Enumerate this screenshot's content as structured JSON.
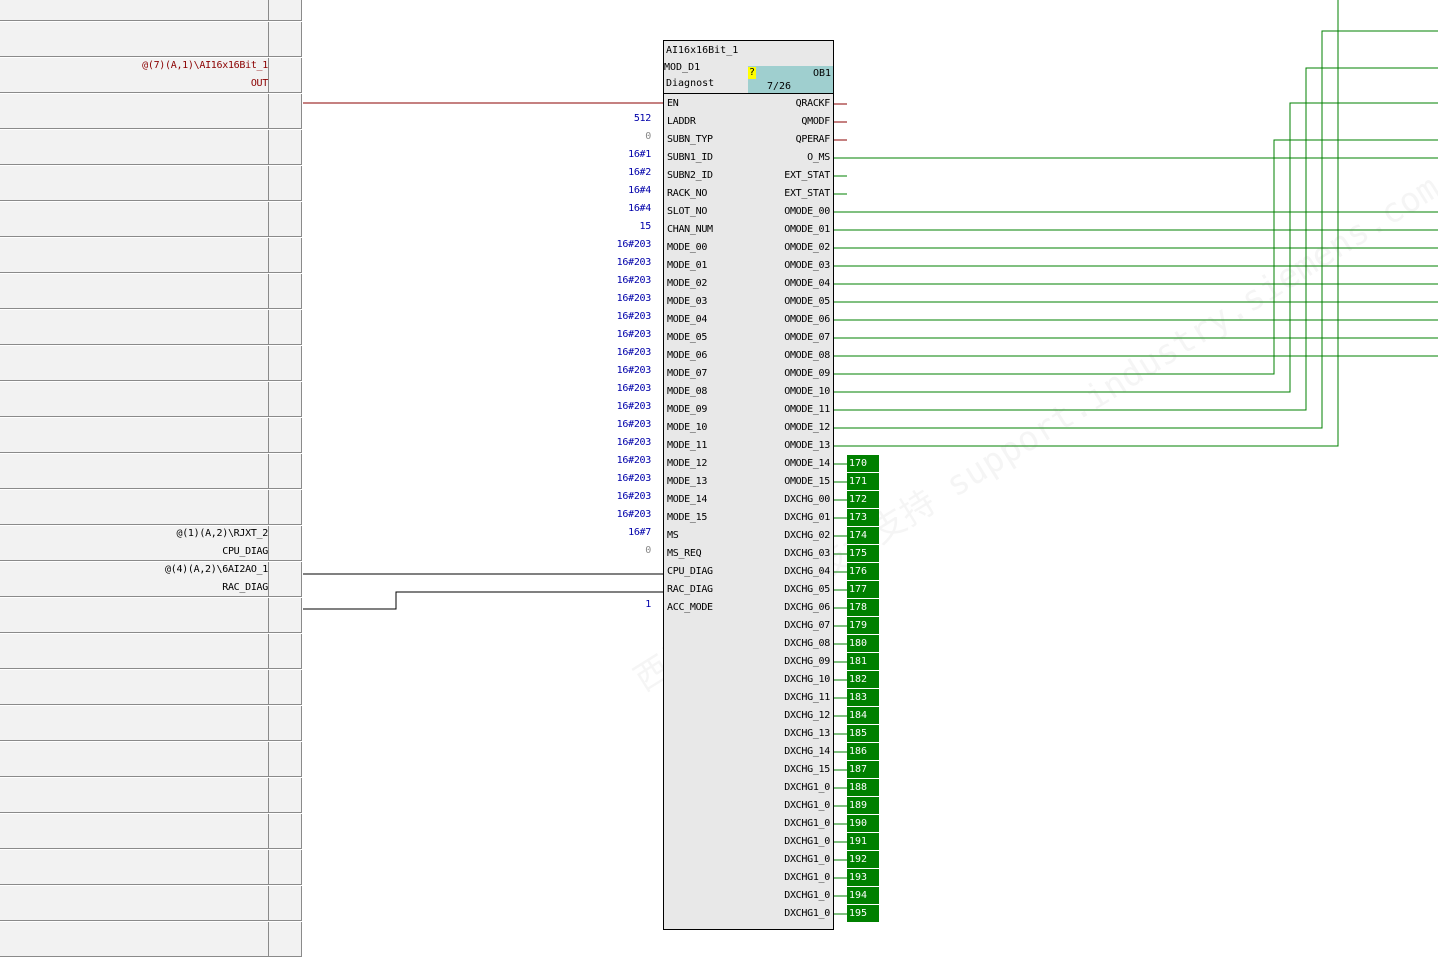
{
  "margin_connections": [
    {
      "row": 2,
      "line1": "@(7)(A,1)\\AI16x16Bit_1",
      "line2": "OUT",
      "color": "#8b0000"
    },
    {
      "row": 15,
      "line1": "@(1)(A,2)\\RJXT_2",
      "line2": "CPU_DIAG",
      "color": "#000000"
    },
    {
      "row": 16,
      "line1": "@(4)(A,2)\\6AI2AO_1",
      "line2": "RAC_DIAG",
      "color": "#000000"
    }
  ],
  "block": {
    "name": "AI16x16Bit_1",
    "type": "MOD_D1",
    "comment": "Diagnost",
    "ob_flag": "?",
    "ob_name": "OB1",
    "run_sequence": "7/26",
    "inputs": [
      {
        "name": "EN",
        "value": ""
      },
      {
        "name": "LADDR",
        "value": "512"
      },
      {
        "name": "SUBN_TYP",
        "value": "0"
      },
      {
        "name": "SUBN1_ID",
        "value": "16#1"
      },
      {
        "name": "SUBN2_ID",
        "value": "16#2"
      },
      {
        "name": "RACK_NO",
        "value": "16#4"
      },
      {
        "name": "SLOT_NO",
        "value": "16#4"
      },
      {
        "name": "CHAN_NUM",
        "value": "15"
      },
      {
        "name": "MODE_00",
        "value": "16#203"
      },
      {
        "name": "MODE_01",
        "value": "16#203"
      },
      {
        "name": "MODE_02",
        "value": "16#203"
      },
      {
        "name": "MODE_03",
        "value": "16#203"
      },
      {
        "name": "MODE_04",
        "value": "16#203"
      },
      {
        "name": "MODE_05",
        "value": "16#203"
      },
      {
        "name": "MODE_06",
        "value": "16#203"
      },
      {
        "name": "MODE_07",
        "value": "16#203"
      },
      {
        "name": "MODE_08",
        "value": "16#203"
      },
      {
        "name": "MODE_09",
        "value": "16#203"
      },
      {
        "name": "MODE_10",
        "value": "16#203"
      },
      {
        "name": "MODE_11",
        "value": "16#203"
      },
      {
        "name": "MODE_12",
        "value": "16#203"
      },
      {
        "name": "MODE_13",
        "value": "16#203"
      },
      {
        "name": "MODE_14",
        "value": "16#203"
      },
      {
        "name": "MODE_15",
        "value": "16#203"
      },
      {
        "name": "MS",
        "value": "16#7"
      },
      {
        "name": "MS_REQ",
        "value": "0"
      },
      {
        "name": "CPU_DIAG",
        "value": ""
      },
      {
        "name": "RAC_DIAG",
        "value": ""
      },
      {
        "name": "ACC_MODE",
        "value": "1"
      }
    ],
    "outputs": [
      "QRACKF",
      "QMODF",
      "QPERAF",
      "O_MS",
      "EXT_STAT",
      "EXT_STAT",
      "OMODE_00",
      "OMODE_01",
      "OMODE_02",
      "OMODE_03",
      "OMODE_04",
      "OMODE_05",
      "OMODE_06",
      "OMODE_07",
      "OMODE_08",
      "OMODE_09",
      "OMODE_10",
      "OMODE_11",
      "OMODE_12",
      "OMODE_13",
      "OMODE_14",
      "OMODE_15",
      "DXCHG_00",
      "DXCHG_01",
      "DXCHG_02",
      "DXCHG_03",
      "DXCHG_04",
      "DXCHG_05",
      "DXCHG_06",
      "DXCHG_07",
      "DXCHG_08",
      "DXCHG_09",
      "DXCHG_10",
      "DXCHG_11",
      "DXCHG_12",
      "DXCHG_13",
      "DXCHG_14",
      "DXCHG_15",
      "DXCHG1_0",
      "DXCHG1_0",
      "DXCHG1_0",
      "DXCHG1_0",
      "DXCHG1_0",
      "DXCHG1_0",
      "DXCHG1_0",
      "DXCHG1_0"
    ],
    "output_refs": [
      "170",
      "171",
      "172",
      "173",
      "174",
      "175",
      "176",
      "177",
      "178",
      "179",
      "180",
      "181",
      "182",
      "183",
      "184",
      "185",
      "186",
      "187",
      "188",
      "189",
      "190",
      "191",
      "192",
      "193",
      "194",
      "195"
    ]
  },
  "colors": {
    "wire_green": "#008000",
    "wire_red": "#8b0000",
    "value_blue": "#0000aa",
    "ref_box": "#008000",
    "ob_box": "#9fcfcf"
  },
  "watermark": "西门子 工业 技术支持 support.industry.siemens.com/cs"
}
